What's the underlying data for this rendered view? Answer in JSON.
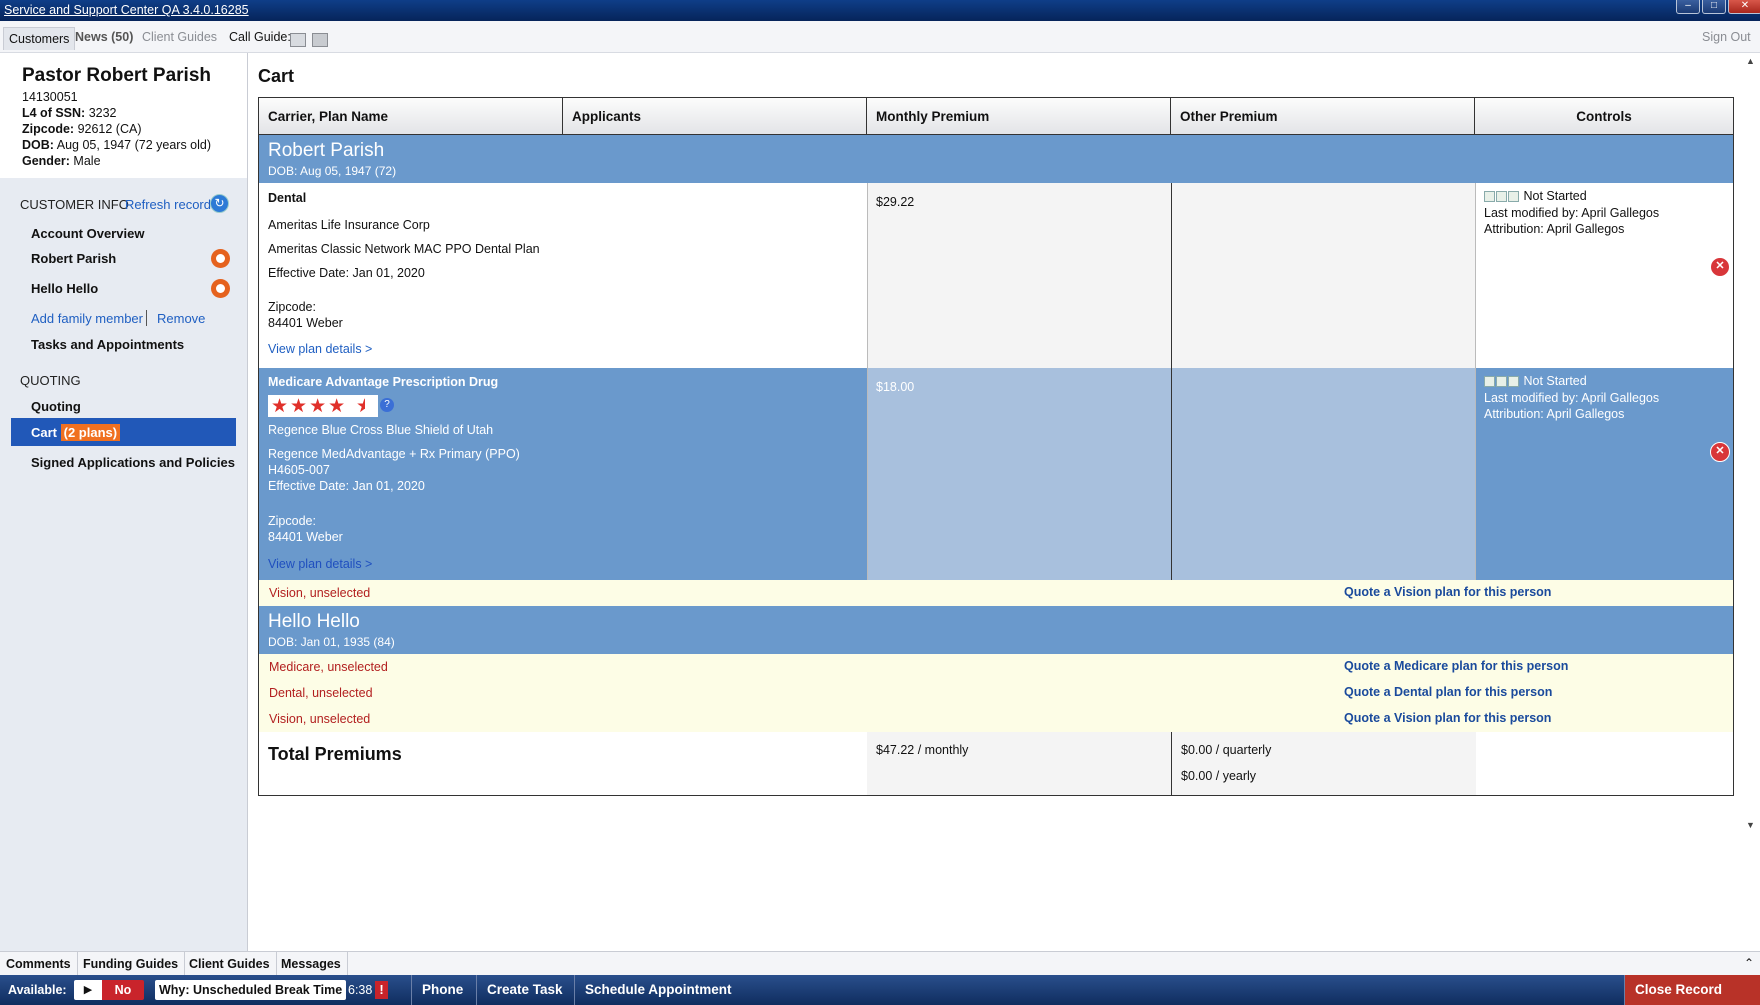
{
  "window": {
    "title": "Service and Support Center QA 3.4.0.16285"
  },
  "topbar": {
    "tabs": [
      "Customers",
      "News (50)",
      "Client Guides"
    ],
    "call_guide": "Call Guide:",
    "sign_out": "Sign Out"
  },
  "customer": {
    "name": "Pastor Robert Parish",
    "id": "14130051",
    "ssn_label": "L4 of SSN:",
    "ssn": "3232",
    "zip_label": "Zipcode:",
    "zip": "92612 (CA)",
    "dob_label": "DOB:",
    "dob": "Aug 05, 1947 (72 years old)",
    "gender_label": "Gender:",
    "gender": "Male"
  },
  "sidebar": {
    "customer_info": "CUSTOMER INFO",
    "refresh": "Refresh record",
    "account_overview": "Account Overview",
    "member1": "Robert Parish",
    "member2": "Hello Hello",
    "add_family": "Add family member",
    "remove": "Remove",
    "tasks": "Tasks and Appointments",
    "quoting_header": "QUOTING",
    "quoting": "Quoting",
    "cart": "Cart",
    "cart_badge": "(2 plans)",
    "signed": "Signed Applications and Policies"
  },
  "cart": {
    "title": "Cart",
    "headers": [
      "Carrier, Plan Name",
      "Applicants",
      "Monthly Premium",
      "Other Premium",
      "Controls"
    ],
    "person1": {
      "name": "Robert Parish",
      "dob": "DOB: Aug 05, 1947 (72)"
    },
    "plan1": {
      "type": "Dental",
      "carrier": "Ameritas Life Insurance Corp",
      "plan": "Ameritas Classic Network MAC PPO Dental Plan",
      "effective": "Effective Date: Jan 01, 2020",
      "zip_label": "Zipcode:",
      "zip": "84401 Weber",
      "details": "View plan details >",
      "monthly": "$29.22",
      "status": "Not Started",
      "modified": "Last modified by: April Gallegos",
      "attribution": "Attribution: April Gallegos"
    },
    "plan2": {
      "type": "Medicare Advantage Prescription Drug",
      "rating": 4.5,
      "carrier": "Regence Blue Cross Blue Shield of Utah",
      "plan": "Regence MedAdvantage + Rx Primary (PPO)",
      "code": "H4605-007",
      "effective": "Effective Date: Jan 01, 2020",
      "zip_label": "Zipcode:",
      "zip": "84401 Weber",
      "details": "View plan details >",
      "monthly": "$18.00",
      "status": "Not Started",
      "modified": "Last modified by: April Gallegos",
      "attribution": "Attribution: April Gallegos"
    },
    "p1_vision": {
      "label": "Vision, unselected",
      "action": "Quote a Vision plan for this person"
    },
    "person2": {
      "name": "Hello Hello",
      "dob": "DOB: Jan 01, 1935 (84)"
    },
    "p2_medicare": {
      "label": "Medicare, unselected",
      "action": "Quote a Medicare plan for this person"
    },
    "p2_dental": {
      "label": "Dental, unselected",
      "action": "Quote a Dental plan for this person"
    },
    "p2_vision": {
      "label": "Vision, unselected",
      "action": "Quote a Vision plan for this person"
    },
    "totals": {
      "label": "Total Premiums",
      "monthly": "$47.22 / monthly",
      "quarterly": "$0.00 / quarterly",
      "yearly": "$0.00 / yearly"
    }
  },
  "bottom": {
    "tabs": [
      "Comments",
      "Funding Guides",
      "Client Guides",
      "Messages"
    ],
    "available": "Available:",
    "no": "No",
    "why": "Why: Unscheduled Break Time",
    "timer": "6:38",
    "phone": "Phone",
    "create_task": "Create Task",
    "schedule": "Schedule Appointment",
    "close": "Close Record"
  },
  "colors": {
    "titlebar": "#0b3274",
    "person_row": "#6a99cc",
    "selected_row": "#6a99cc",
    "accent": "#2158b8",
    "badge": "#f07020",
    "close": "#b83228"
  }
}
